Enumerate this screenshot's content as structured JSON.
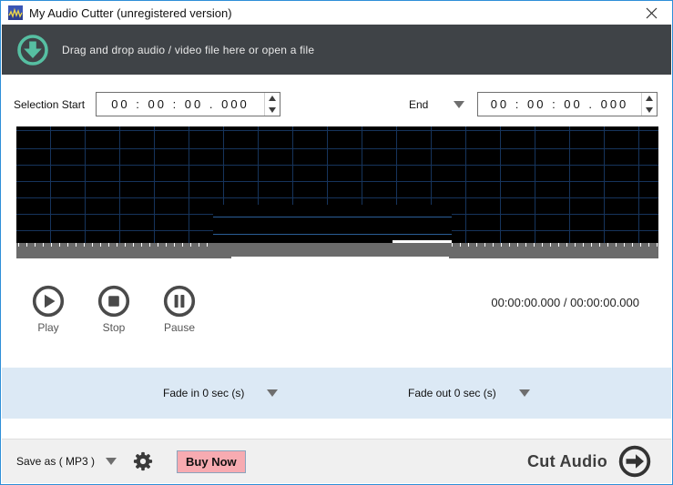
{
  "window": {
    "title": "My Audio Cutter (unregistered version)"
  },
  "dropzone": {
    "text": "Drag and drop audio / video file here or open a file"
  },
  "selection": {
    "start_label": "Selection Start",
    "start_value": "00 : 00 : 00 . 000",
    "end_label": "End",
    "end_value": "00 : 00 : 00 . 000"
  },
  "transport": {
    "play_label": "Play",
    "stop_label": "Stop",
    "pause_label": "Pause",
    "time_display": "00:00:00.000 / 00:00:00.000"
  },
  "fade": {
    "fade_in_label": "Fade in 0 sec (s)",
    "fade_out_label": "Fade out 0 sec (s)"
  },
  "footer": {
    "save_as_label": "Save as ( MP3 )",
    "buy_now_label": "Buy Now",
    "cut_audio_label": "Cut Audio"
  },
  "colors": {
    "accent_border": "#2e8fd8",
    "dropzone_bg": "#3f4347",
    "teal_icon": "#56bfa2",
    "grid_line": "#16345c",
    "channel_line": "#2a5d96",
    "ruler_gray": "#6b6b6b",
    "fade_bar_bg": "#dce9f5",
    "footer_bg": "#f0f0f0",
    "buy_now_pink": "#f7abb1",
    "icon_dark": "#4a4a4a"
  }
}
